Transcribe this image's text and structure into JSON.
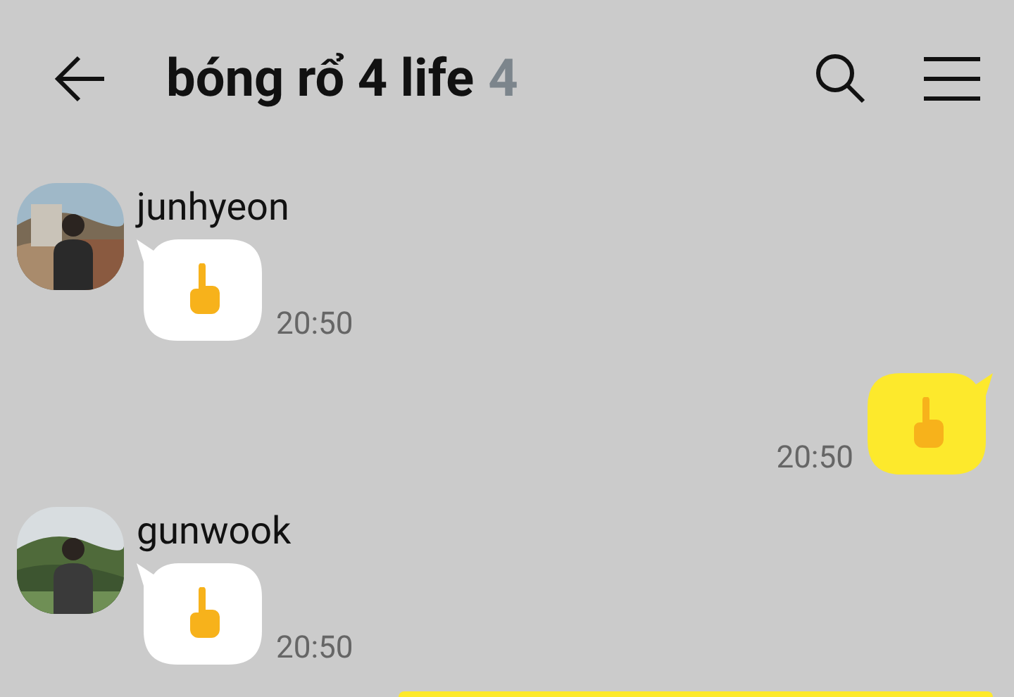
{
  "header": {
    "title": "bóng rổ 4 life",
    "member_count": "4"
  },
  "messages": [
    {
      "outgoing": false,
      "sender": "junhyeon",
      "kind": "emoji",
      "time": "20:50"
    },
    {
      "outgoing": true,
      "kind": "emoji",
      "time": "20:50"
    },
    {
      "outgoing": false,
      "sender": "gunwook",
      "kind": "emoji",
      "time": "20:50"
    },
    {
      "outgoing": true,
      "kind": "cut"
    }
  ]
}
